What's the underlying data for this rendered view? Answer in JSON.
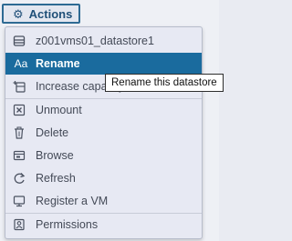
{
  "toolbar": {
    "actions_label": "Actions",
    "actions_icon": "gear-icon"
  },
  "menu": {
    "header": {
      "label": "z001vms01_datastore1",
      "icon": "datastore-icon"
    },
    "items": [
      {
        "label": "Rename",
        "icon": "rename-icon",
        "selected": true
      },
      {
        "label": "Increase capacity",
        "icon": "increase-capacity-icon"
      },
      {
        "label": "Unmount",
        "icon": "unmount-icon"
      },
      {
        "label": "Delete",
        "icon": "delete-icon"
      },
      {
        "label": "Browse",
        "icon": "browse-icon"
      },
      {
        "label": "Refresh",
        "icon": "refresh-icon"
      },
      {
        "label": "Register a VM",
        "icon": "register-vm-icon"
      },
      {
        "label": "Permissions",
        "icon": "permissions-icon"
      }
    ]
  },
  "tooltip": {
    "text": "Rename this datastore"
  },
  "colors": {
    "accent": "#1a6b9e",
    "menu_bg": "#e7e9f3",
    "text": "#444a57"
  }
}
